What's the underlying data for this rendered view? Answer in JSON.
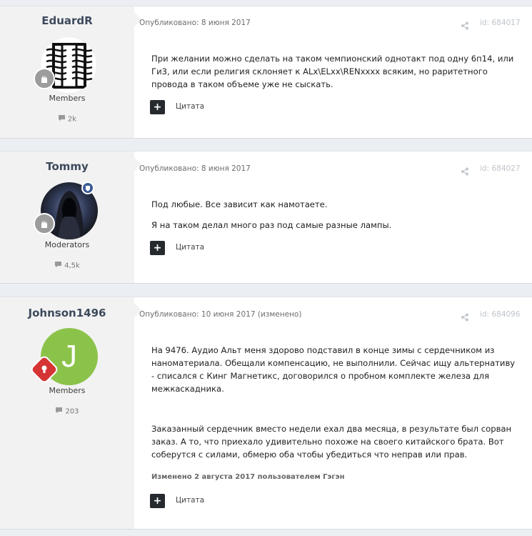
{
  "posts": [
    {
      "author": "EduardR",
      "group": "Members",
      "post_count": "2k",
      "published": "Опубликовано: 8 июня 2017",
      "id_text": "id: 684017",
      "paragraphs": [
        "При желании можно сделать на таком чемпионский однотакт под одну 6п14, или Ги3, или если религия склоняет к ALx\\ELxx\\RENxxxx всяким, но раритетного провода в таком объеме уже не сыскать."
      ],
      "quote_label": "Цитата"
    },
    {
      "author": "Tommy",
      "group": "Moderators",
      "post_count": "4,5k",
      "published": "Опубликовано: 8 июня 2017",
      "id_text": "id: 684027",
      "paragraphs": [
        "Под любые. Все зависит как намотаете.",
        "Я на таком делал много раз под самые разные лампы."
      ],
      "quote_label": "Цитата"
    },
    {
      "author": "Johnson1496",
      "avatar_letter": "J",
      "group": "Members",
      "post_count": "203",
      "published": "Опубликовано: 10 июня 2017 (изменено)",
      "id_text": "id: 684096",
      "paragraphs": [
        "На 9476. Аудио Альт меня здорово подставил в конце зимы с сердечником из наноматериала. Обещали компенсацию, не выполнили. Сейчас ищу альтернативу - списался с Кинг Магнетикс, договорился о пробном комплекте железа для межкаскадника.",
        "Заказанный сердечник вместо недели ехал два месяца, в результате был сорван заказ. А то, что приехало удивительно похоже на своего китайского брата. Вот соберутся с силами, обмерю оба чтобы убедиться что неправ или прав."
      ],
      "edited_note": "Изменено 2 августа 2017 пользователем Гэгэн",
      "quote_label": "Цитата"
    }
  ],
  "colors": {
    "avatar_green": "#8bc34a",
    "rank_grey": "#9c9c9c",
    "rank_red": "#d53434",
    "moderator_badge": "#3d5a96"
  }
}
